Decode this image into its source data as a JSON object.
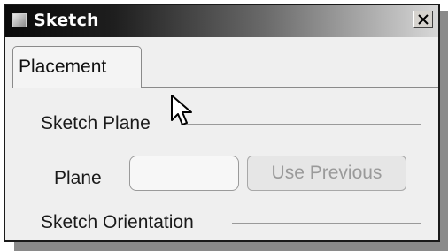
{
  "window": {
    "title": "Sketch",
    "close_icon": "close-icon",
    "app_icon": "window-icon"
  },
  "tabs": [
    {
      "label": "Placement",
      "active": true
    }
  ],
  "placement": {
    "sketch_plane": {
      "heading": "Sketch Plane",
      "plane_label": "Plane",
      "plane_value": "",
      "use_previous_label": "Use Previous",
      "use_previous_enabled": false
    },
    "sketch_orientation": {
      "heading": "Sketch Orientation"
    }
  },
  "colors": {
    "titlebar_start": "#0a0a0a",
    "titlebar_end": "#d8d8d8",
    "dialog_bg": "#efefef",
    "disabled_text": "#9a9a9a"
  }
}
